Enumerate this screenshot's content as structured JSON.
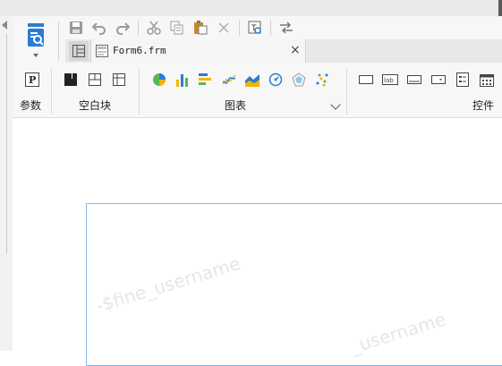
{
  "quick_access": {
    "save": "save-icon",
    "undo": "undo-icon",
    "redo": "redo-icon",
    "cut": "cut-icon",
    "copy": "copy-icon",
    "paste": "paste-icon",
    "delete": "delete-icon",
    "template": "template-icon",
    "switch": "switch-icon"
  },
  "tab": {
    "label": "Form6.frm",
    "close": "×"
  },
  "ribbon": {
    "param_label": "参数",
    "param_icon_text": "P",
    "blank_block_label": "空白块",
    "chart_label": "图表",
    "control_label": "控件",
    "control_text_lab": "lab"
  },
  "watermark": {
    "text": "-$fine_username",
    "text2": "_username"
  },
  "colors": {
    "accent": "#2b7cd3",
    "frame_border": "#7fb7e6"
  }
}
